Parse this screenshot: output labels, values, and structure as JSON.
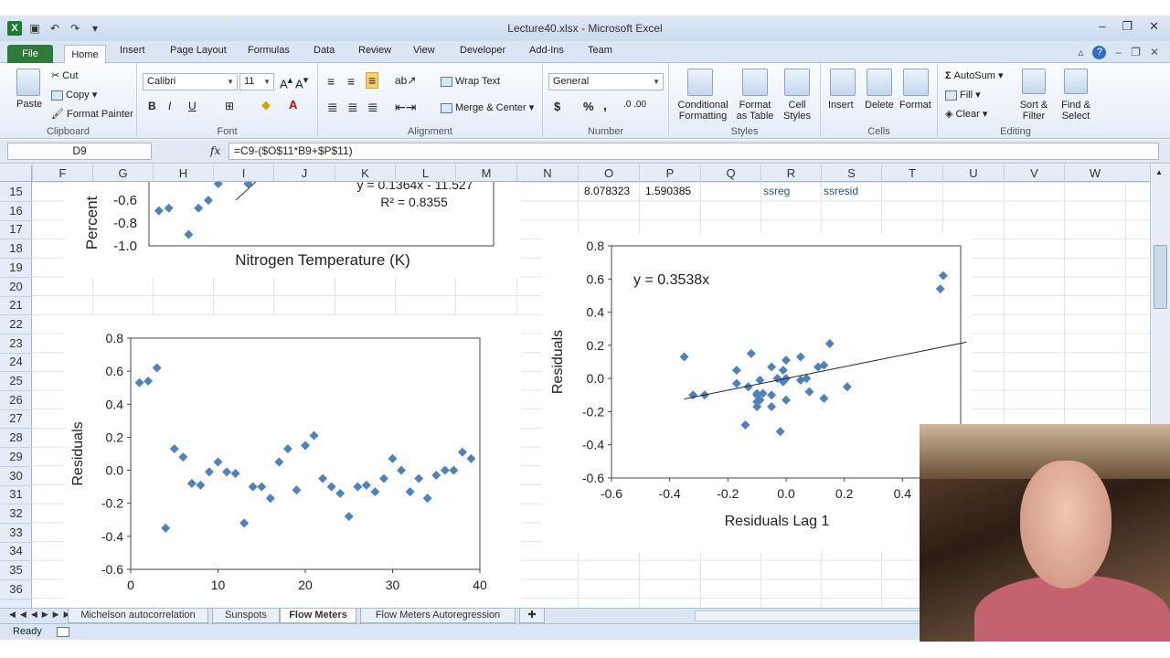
{
  "window": {
    "title": "Lecture40.xlsx - Microsoft Excel"
  },
  "tabs": [
    "File",
    "Home",
    "Insert",
    "Page Layout",
    "Formulas",
    "Data",
    "Review",
    "View",
    "Developer",
    "Add-Ins",
    "Team"
  ],
  "ribbon": {
    "clipboard": {
      "label": "Clipboard",
      "paste": "Paste",
      "cut": "Cut",
      "copy": "Copy",
      "format_painter": "Format Painter"
    },
    "font": {
      "label": "Font",
      "name": "Calibri",
      "size": "11",
      "bold": "B",
      "italic": "I",
      "underline": "U"
    },
    "alignment": {
      "label": "Alignment",
      "wrap": "Wrap Text",
      "merge": "Merge & Center"
    },
    "number": {
      "label": "Number",
      "format": "General",
      "currency": "$",
      "percent": "%",
      "comma": ","
    },
    "styles": {
      "label": "Styles",
      "conditional": "Conditional Formatting",
      "format_table": "Format as Table",
      "cell_styles": "Cell Styles"
    },
    "cells": {
      "label": "Cells",
      "insert": "Insert",
      "delete": "Delete",
      "format": "Format"
    },
    "editing": {
      "label": "Editing",
      "autosum": "AutoSum",
      "fill": "Fill",
      "clear": "Clear",
      "sort": "Sort & Filter",
      "find": "Find & Select"
    }
  },
  "formula_bar": {
    "name_box": "D9",
    "fx": "fx",
    "formula": "=C9-($O$11*B9+$P$11)"
  },
  "columns": [
    "F",
    "G",
    "H",
    "I",
    "J",
    "K",
    "L",
    "M",
    "N",
    "O",
    "P",
    "Q",
    "R",
    "S",
    "T",
    "U",
    "V",
    "W"
  ],
  "rows": [
    "15",
    "16",
    "17",
    "18",
    "19",
    "20",
    "21",
    "22",
    "23",
    "24",
    "25",
    "26",
    "27",
    "28",
    "29",
    "30",
    "31",
    "32",
    "33",
    "34",
    "35",
    "36"
  ],
  "cells": {
    "o15": "8.078323",
    "p15": "1.590385",
    "r15": "ssreg",
    "s15": "ssresid"
  },
  "chart_data": [
    {
      "type": "scatter",
      "title": "",
      "xlabel": "Nitrogen Temperature (K)",
      "ylabel": "Percent",
      "yticks": [
        "-0.6",
        "-0.8",
        "-1.0"
      ],
      "trendline_label": "y = 0.1364x - 11.527",
      "r2_label": "R² = 0.8355",
      "series": [
        {
          "x": [
            0.21,
            0.22,
            0.24,
            0.25,
            0.26,
            0.27,
            0.3
          ],
          "y": [
            -0.72,
            -0.7,
            -0.9,
            -0.7,
            -0.64,
            -0.5,
            -0.4
          ]
        }
      ]
    },
    {
      "type": "scatter",
      "title": "",
      "xlabel": "",
      "ylabel": "Residuals",
      "xlim": [
        0,
        40
      ],
      "ylim": [
        -0.6,
        0.8
      ],
      "xticks": [
        "0",
        "10",
        "20",
        "30",
        "40"
      ],
      "yticks": [
        "0.8",
        "0.6",
        "0.4",
        "0.2",
        "0.0",
        "-0.2",
        "-0.4",
        "-0.6"
      ],
      "series": [
        {
          "x": [
            1,
            2,
            3,
            4,
            5,
            6,
            7,
            8,
            9,
            10,
            11,
            12,
            13,
            14,
            15,
            16,
            17,
            18,
            19,
            20,
            21,
            22,
            23,
            24,
            25,
            26,
            27,
            28,
            29,
            30,
            31,
            32,
            33,
            34,
            35,
            36,
            37,
            38,
            39
          ],
          "y": [
            0.53,
            0.54,
            0.62,
            -0.35,
            0.13,
            0.08,
            -0.08,
            -0.09,
            -0.01,
            0.05,
            -0.01,
            -0.02,
            -0.32,
            -0.1,
            -0.1,
            -0.17,
            0.05,
            0.13,
            -0.12,
            0.15,
            0.21,
            -0.05,
            -0.1,
            -0.14,
            -0.28,
            -0.1,
            -0.09,
            -0.13,
            -0.05,
            0.07,
            0.0,
            -0.13,
            -0.05,
            -0.17,
            -0.03,
            0.0,
            0.0,
            0.11,
            0.07
          ]
        }
      ]
    },
    {
      "type": "scatter",
      "title": "",
      "xlabel": "Residuals Lag 1",
      "ylabel": "Residuals",
      "xlim": [
        -0.6,
        0.6
      ],
      "ylim": [
        -0.6,
        0.8
      ],
      "xticks": [
        "-0.6",
        "-0.4",
        "-0.2",
        "0.0",
        "0.2",
        "0.4",
        "0.6"
      ],
      "yticks": [
        "0.8",
        "0.6",
        "0.4",
        "0.2",
        "0.0",
        "-0.2",
        "-0.4",
        "-0.6"
      ],
      "trendline_label": "y = 0.3538x",
      "trendline_slope": 0.3538,
      "series": [
        {
          "x": [
            0.53,
            0.54,
            0.62,
            -0.35,
            0.13,
            0.08,
            -0.08,
            -0.09,
            -0.01,
            0.05,
            -0.01,
            -0.02,
            -0.32,
            -0.1,
            -0.1,
            -0.17,
            0.05,
            0.13,
            -0.12,
            0.15,
            0.21,
            -0.05,
            -0.1,
            -0.14,
            -0.28,
            -0.1,
            -0.09,
            -0.13,
            -0.05,
            0.07,
            0.0,
            -0.13,
            -0.05,
            -0.17,
            -0.03,
            0.0,
            0.0,
            0.11
          ],
          "y": [
            0.54,
            0.62,
            -0.35,
            0.13,
            0.08,
            -0.08,
            -0.09,
            -0.01,
            0.05,
            -0.01,
            -0.02,
            -0.32,
            -0.1,
            -0.1,
            -0.17,
            0.05,
            0.13,
            -0.12,
            0.15,
            0.21,
            -0.05,
            -0.1,
            -0.14,
            -0.28,
            -0.1,
            -0.09,
            -0.13,
            -0.05,
            0.07,
            0.0,
            -0.13,
            -0.05,
            -0.17,
            -0.03,
            0.0,
            0.0,
            0.11,
            0.07
          ]
        }
      ]
    }
  ],
  "sheet_tabs": [
    "Michelson autocorrelation",
    "Sunspots",
    "Flow Meters",
    "Flow Meters Autoregression"
  ],
  "active_sheet": "Flow Meters",
  "status": {
    "text": "Ready"
  },
  "colors": {
    "marker": "#4f81bd",
    "ribbon_accent": "#2d7a3a"
  }
}
